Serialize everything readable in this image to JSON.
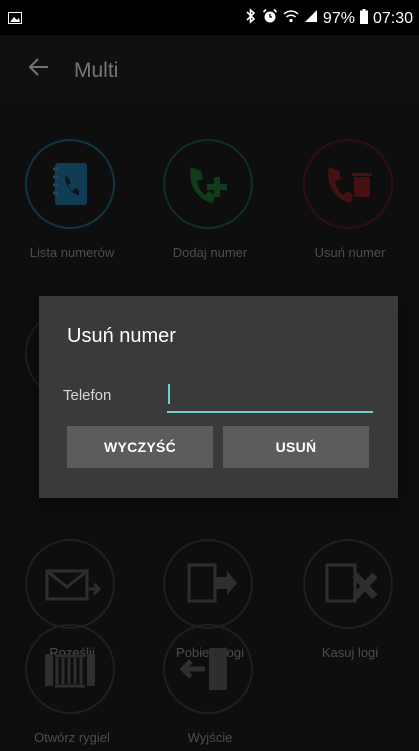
{
  "status_bar": {
    "battery": "97%",
    "time": "07:30"
  },
  "app_bar": {
    "title": "Multi"
  },
  "tiles": [
    {
      "label": "Lista numerów"
    },
    {
      "label": "Dodaj numer"
    },
    {
      "label": "Usuń numer"
    },
    {
      "label": "Roześlij"
    },
    {
      "label": "Pobierz logi"
    },
    {
      "label": "Kasuj logi"
    },
    {
      "label": "Otwórz rygiel"
    },
    {
      "label": "Wyjście"
    }
  ],
  "dialog": {
    "title": "Usuń numer",
    "field_label": "Telefon",
    "field_value": "",
    "clear_button": "WYCZYŚĆ",
    "delete_button": "USUŃ"
  },
  "colors": {
    "accent": "#6ad3cd",
    "dialog_bg": "#3a3a3a",
    "button_bg": "#5c5c5c"
  }
}
